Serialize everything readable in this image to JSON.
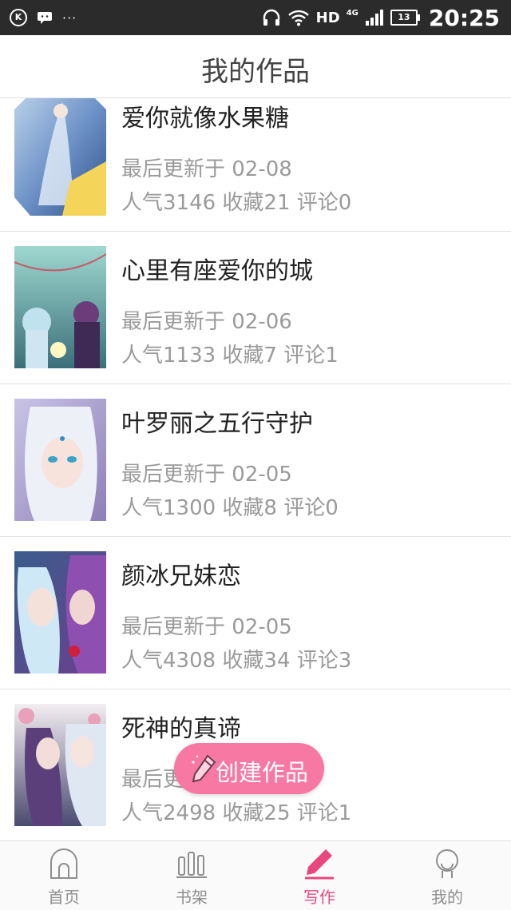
{
  "status_bar": {
    "left_icons": [
      "k-icon",
      "chat-icon"
    ],
    "more": "···",
    "network": "HD",
    "network_sub": "4G",
    "battery": "13",
    "time": "20:25"
  },
  "header": {
    "title": "我的作品"
  },
  "works": [
    {
      "title": "爱你就像水果糖",
      "updated": "最后更新于 02-08",
      "stats": "人气3146 收藏21 评论0"
    },
    {
      "title": "心里有座爱你的城",
      "updated": "最后更新于 02-06",
      "stats": "人气1133 收藏7 评论1"
    },
    {
      "title": "叶罗丽之五行守护",
      "updated": "最后更新于 02-05",
      "stats": "人气1300 收藏8 评论0"
    },
    {
      "title": "颜冰兄妹恋",
      "updated": "最后更新于 02-05",
      "stats": "人气4308 收藏34 评论3"
    },
    {
      "title": "死神的真谛",
      "updated": "最后更新于 02-05",
      "stats": "人气2498 收藏25 评论1"
    }
  ],
  "fab": {
    "label": "创建作品"
  },
  "tabs": [
    {
      "label": "首页",
      "icon": "home-icon"
    },
    {
      "label": "书架",
      "icon": "bookshelf-icon"
    },
    {
      "label": "写作",
      "icon": "pen-icon",
      "active": true
    },
    {
      "label": "我的",
      "icon": "profile-icon"
    }
  ],
  "colors": {
    "accent": "#e8467f",
    "fab": "#f779a3",
    "statusbar": "#2b2b2b"
  }
}
